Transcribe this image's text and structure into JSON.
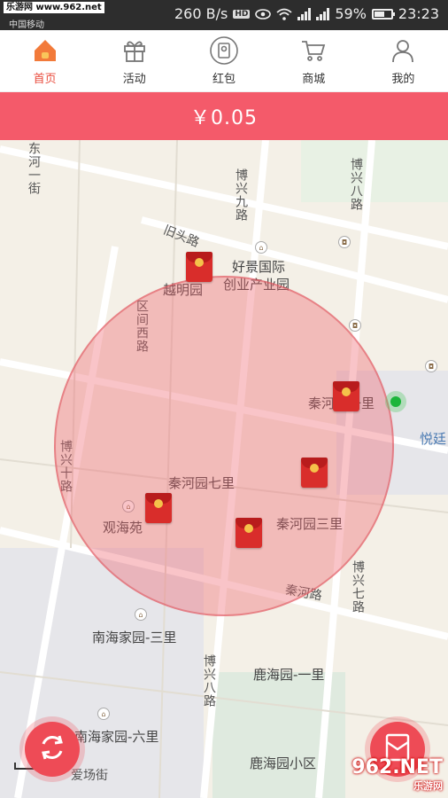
{
  "status_bar": {
    "watermark": "乐游网 www.962.net",
    "carrier": "中国移动",
    "speed": "260 B/s",
    "hd": "HD",
    "network": "4G",
    "battery": "59%",
    "time": "23:23"
  },
  "nav": {
    "tabs": [
      {
        "label": "首页",
        "icon": "home-icon",
        "active": true
      },
      {
        "label": "活动",
        "icon": "gift-icon",
        "active": false
      },
      {
        "label": "红包",
        "icon": "red-packet-icon",
        "active": false
      },
      {
        "label": "商城",
        "icon": "cart-icon",
        "active": false
      },
      {
        "label": "我的",
        "icon": "user-icon",
        "active": false
      }
    ]
  },
  "balance": "￥0.05",
  "map": {
    "roads": [
      "东河一街",
      "旧头路",
      "博兴九路",
      "博兴八路",
      "区间西路",
      "博兴十路",
      "秦河路",
      "博兴七路",
      "南海家园-三里",
      "鹿海园-一里",
      "博兴八路",
      "南海家园-六里",
      "鹿海园小区",
      "爱场街",
      "秦河园七里",
      "秦河园三里",
      "秦河园一里",
      "悦廷"
    ],
    "places": [
      "好景国际",
      "创业产业园",
      "越明园",
      "观海苑"
    ],
    "colors": {
      "circle": "#f0646e",
      "envelope": "#d92d2b",
      "accent": "#f45a6a",
      "user": "#1bb53a"
    }
  },
  "watermark_br": {
    "big": "962.NET",
    "small": "乐游网"
  }
}
